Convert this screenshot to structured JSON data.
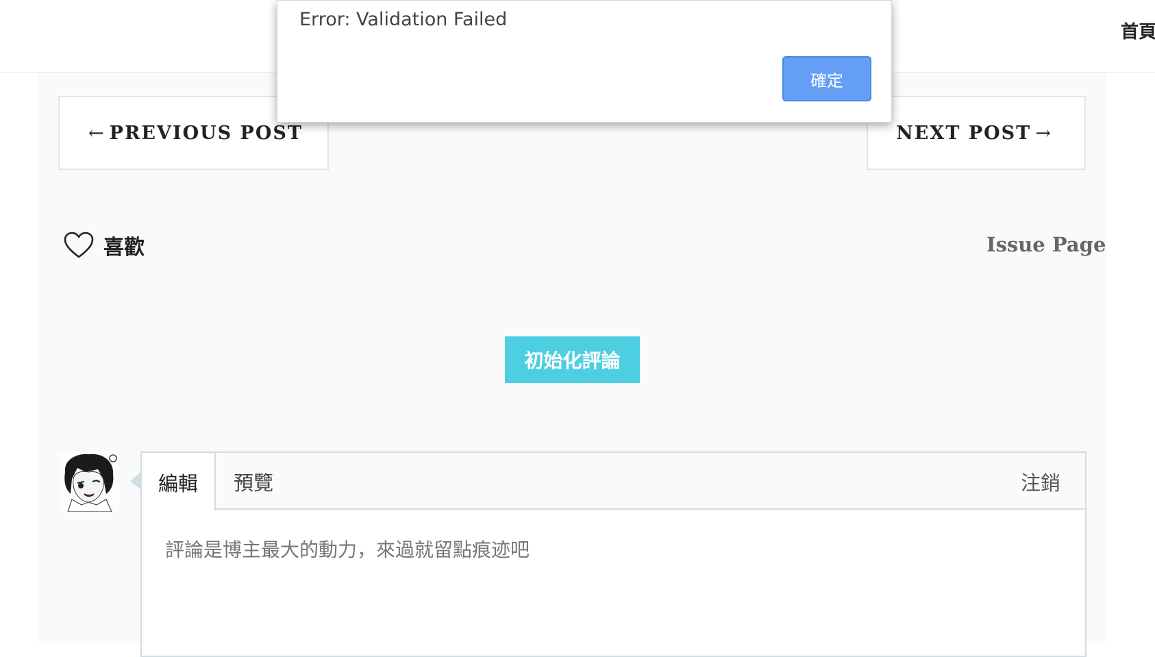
{
  "header": {
    "nav_home": "首頁"
  },
  "post_nav": {
    "prev_arrow": "←",
    "prev_label": "PREVIOUS POST",
    "next_label": "NEXT POST",
    "next_arrow": "→"
  },
  "like": {
    "icon": "heart-outline-icon",
    "label": "喜歡"
  },
  "issue_link": "Issue Page",
  "init_comments_button": "初始化評論",
  "editor": {
    "tabs": {
      "edit": "編輯",
      "preview": "預覽",
      "logout": "注銷"
    },
    "placeholder": "評論是博主最大的動力，來過就留點痕迹吧",
    "value": ""
  },
  "dialog": {
    "message": "Error: Validation Failed",
    "ok_label": "確定"
  },
  "colors": {
    "init_button_bg": "#4ecfe1",
    "dialog_ok_bg": "#649ff5",
    "editor_border": "#d0dde2",
    "content_bg": "#fafafa"
  }
}
